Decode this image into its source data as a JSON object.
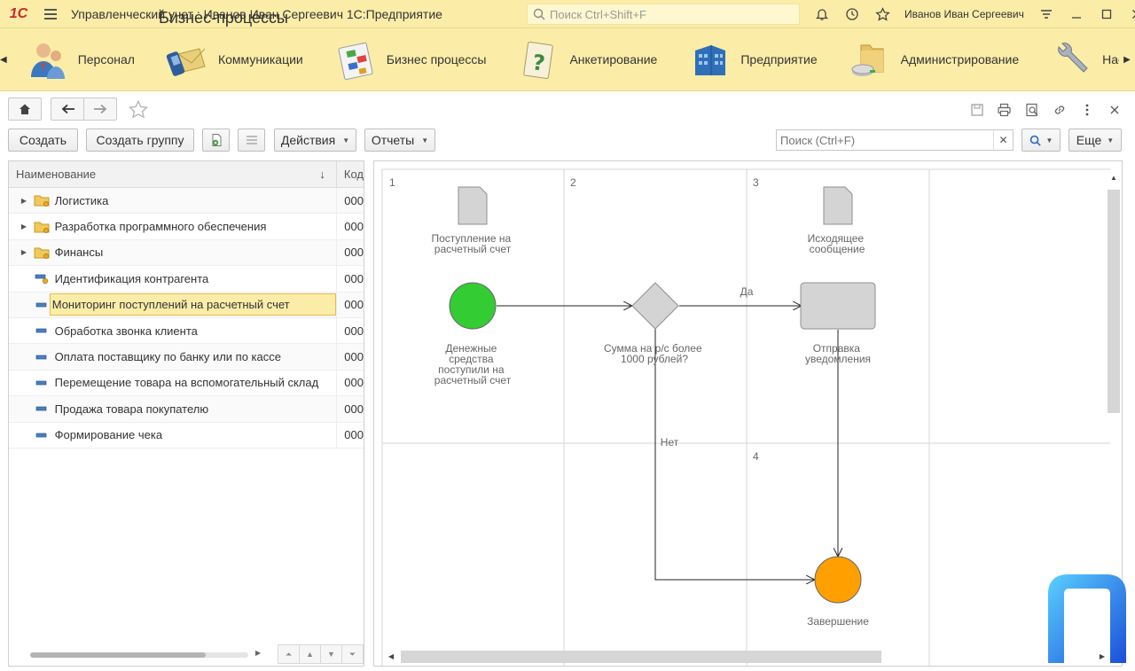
{
  "titlebar": {
    "logo": "1С",
    "title": "Управленческий учет : Иванов Иван Сергеевич 1С:Предприятие",
    "search_placeholder": "Поиск Ctrl+Shift+F",
    "user": "Иванов Иван Сергеевич"
  },
  "sections": [
    {
      "label": "Персонал",
      "icon": "personnel-icon"
    },
    {
      "label": "Коммуникации",
      "icon": "communications-icon"
    },
    {
      "label": "Бизнес процессы",
      "icon": "business-process-icon"
    },
    {
      "label": "Анкетирование",
      "icon": "survey-icon"
    },
    {
      "label": "Предприятие",
      "icon": "enterprise-icon"
    },
    {
      "label": "Администрирование",
      "icon": "administration-icon"
    },
    {
      "label": "Нас",
      "icon": "settings-wrench-icon"
    }
  ],
  "form": {
    "title": "Бизнес-процессы"
  },
  "commands": {
    "create": "Создать",
    "create_group": "Создать группу",
    "actions": "Действия",
    "reports": "Отчеты",
    "search_placeholder": "Поиск (Ctrl+F)",
    "more": "Еще"
  },
  "list": {
    "col_name": "Наименование",
    "col_code": "Код",
    "rows": [
      {
        "name": "Логистика",
        "code": "000",
        "type": "folder"
      },
      {
        "name": "Разработка программного обеспечения",
        "code": "000",
        "type": "folder"
      },
      {
        "name": "Финансы",
        "code": "000",
        "type": "folder"
      },
      {
        "name": "Идентификация контрагента",
        "code": "000",
        "type": "item-marked"
      },
      {
        "name": "Мониторинг поступлений на расчетный счет",
        "code": "000",
        "type": "item",
        "selected": true
      },
      {
        "name": "Обработка звонка клиента",
        "code": "000",
        "type": "item"
      },
      {
        "name": "Оплата поставщику по банку или по кассе",
        "code": "000",
        "type": "item"
      },
      {
        "name": "Перемещение товара на вспомогательный склад",
        "code": "000",
        "type": "item"
      },
      {
        "name": "Продажа товара покупателю",
        "code": "000",
        "type": "item"
      },
      {
        "name": "Формирование чека",
        "code": "000",
        "type": "item"
      }
    ]
  },
  "diagram": {
    "cells": [
      "1",
      "2",
      "3",
      "4"
    ],
    "doc1": [
      "Поступление на",
      "расчетный счет"
    ],
    "doc2": [
      "Исходящее",
      "сообщение"
    ],
    "start": [
      "Денежные",
      "средства",
      "поступили на",
      "расчетный счет"
    ],
    "decision": [
      "Сумма на р/с более",
      "1000 рублей?"
    ],
    "yes": "Да",
    "no": "Нет",
    "task": [
      "Отправка",
      "уведомления"
    ],
    "end": "Завершение",
    "colors": {
      "start": "#33cc33",
      "end": "#ff9f00",
      "shape": "#d4d4d4"
    }
  }
}
